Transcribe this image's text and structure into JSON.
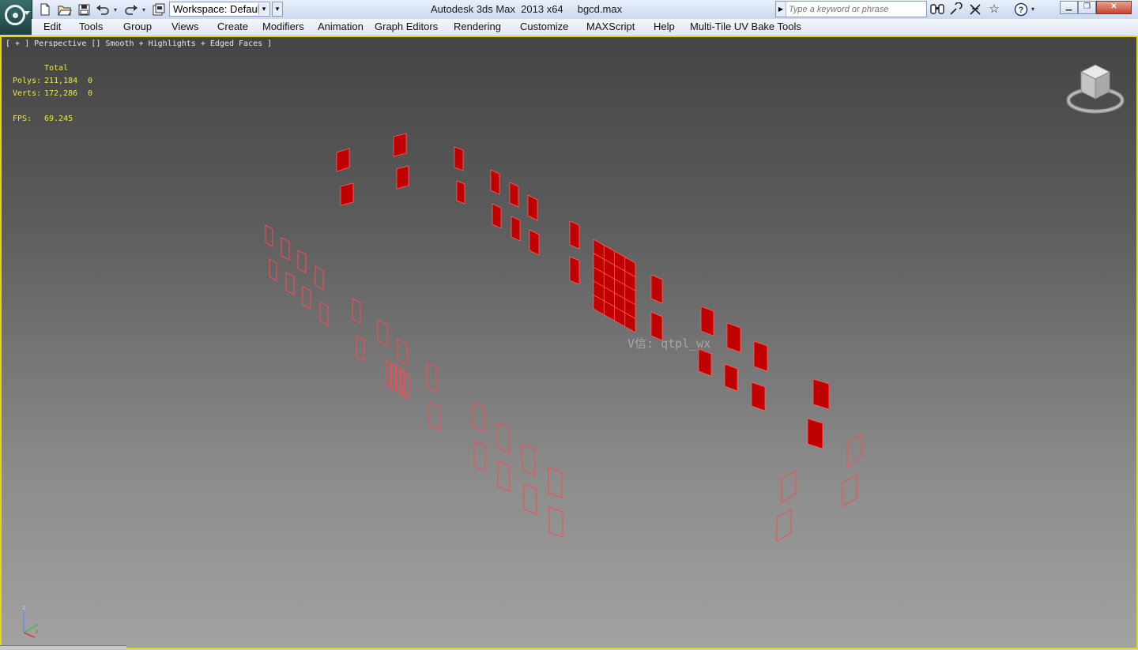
{
  "window": {
    "title": "Autodesk 3ds Max  2013 x64     bgcd.max",
    "workspace": "Workspace: Default",
    "search_placeholder": "Type a keyword or phrase"
  },
  "menu": [
    "Edit",
    "Tools",
    "Group",
    "Views",
    "Create",
    "Modifiers",
    "Animation",
    "Graph Editors",
    "Rendering",
    "Customize",
    "MAXScript",
    "Help",
    "Multi-Tile UV Bake Tools"
  ],
  "viewport": {
    "label": "[ + ] Perspective [] Smooth + Highlights + Edged Faces ]",
    "stats": {
      "total_header": "Total",
      "polys_label": "Polys:",
      "polys_value": "211,184",
      "polys_selected": "0",
      "verts_label": "Verts:",
      "verts_value": "172,286",
      "verts_selected": "0",
      "fps_label": "FPS:",
      "fps_value": "69.245"
    },
    "watermark": "V信: qtpl_wx",
    "axes": {
      "z": "z",
      "y": "y",
      "x": "x"
    }
  },
  "colors": {
    "selected_fill": "#c00000",
    "selected_edge": "#ff6060",
    "wire": "#ff4a4a",
    "viewport_border": "#e3d51e",
    "stats_text": "#f0e64b"
  },
  "icons": [
    "new-file-icon",
    "open-file-icon",
    "save-icon",
    "undo-icon",
    "redo-icon",
    "project-folder-icon",
    "binoculars-icon",
    "communication-center-icon",
    "exchange-icon",
    "favorites-star-icon",
    "help-icon",
    "minimize-icon",
    "restore-icon",
    "close-icon",
    "viewcube-icon",
    "axis-tripod-icon"
  ]
}
